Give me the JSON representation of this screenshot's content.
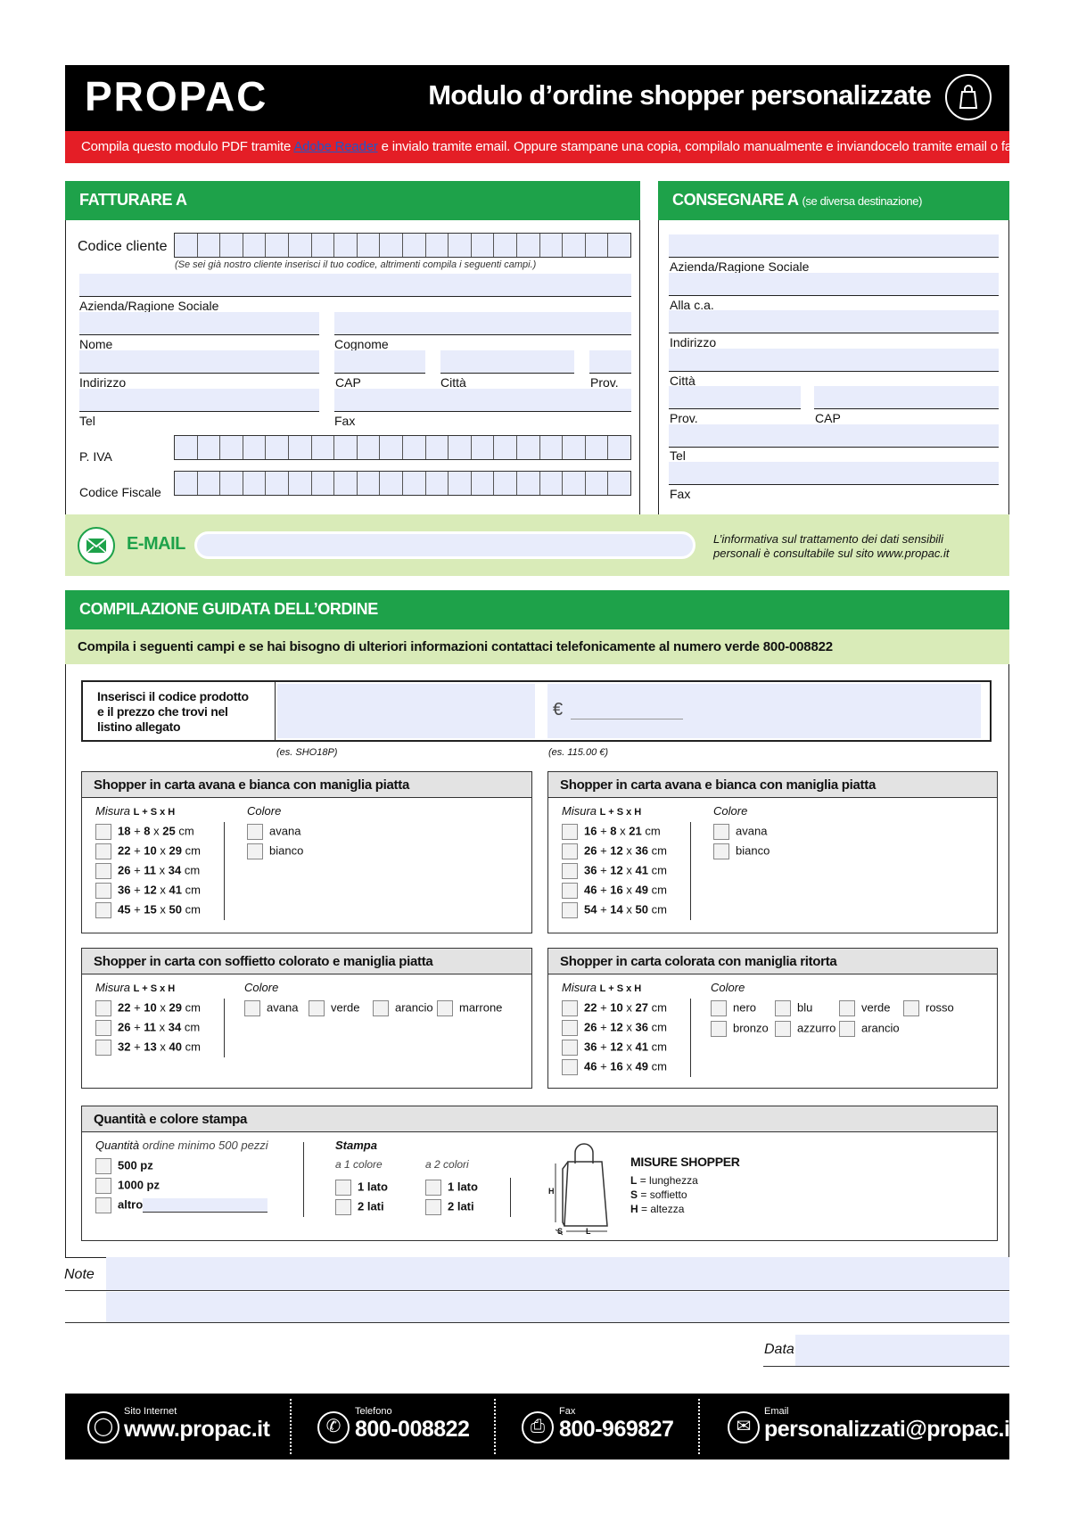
{
  "header": {
    "logo": "PROPAC",
    "title": "Modulo d’ordine shopper personalizzate",
    "instructions_before": "Compila questo modulo PDF tramite ",
    "instructions_link": "Adobe Reader",
    "instructions_after": " e invialo tramite email. Oppure stampane una copia, compilalo manualmente e inviandocelo tramite email o fax."
  },
  "billing": {
    "heading": "FATTURARE A",
    "customer_code_label": "Codice cliente",
    "customer_code_hint": "(Se sei già nostro cliente inserisci il tuo codice, altrimenti compila i seguenti campi.)",
    "company_label": "Azienda/Ragione Sociale",
    "name_label": "Nome",
    "surname_label": "Cognome",
    "address_label": "Indirizzo",
    "cap_label": "CAP",
    "city_label": "Città",
    "prov_label": "Prov.",
    "tel_label": "Tel",
    "fax_label": "Fax",
    "vat_label": "P. IVA",
    "fiscal_label": "Codice Fiscale"
  },
  "shipping": {
    "heading": "CONSEGNARE A",
    "heading_note": "(se diversa destinazione)",
    "company_label": "Azienda/Ragione Sociale",
    "attention_label": "Alla c.a.",
    "address_label": "Indirizzo",
    "city_label": "Città",
    "prov_label": "Prov.",
    "cap_label": "CAP",
    "tel_label": "Tel",
    "fax_label": "Fax"
  },
  "email": {
    "label": "E-MAIL",
    "privacy_text_1": "L’informativa sul trattamento dei dati sensibili",
    "privacy_text_2": "personali è consultabile sul sito www.propac.it"
  },
  "order": {
    "heading": "COMPILAZIONE GUIDATA DELL’ORDINE",
    "instructions": "Compila i seguenti campi e se hai bisogno di ulteriori informazioni contattaci telefonicamente al numero verde 800-008822",
    "product_prompt_1": "Inserisci il codice prodotto",
    "product_prompt_2": "e il prezzo che trovi nel",
    "product_prompt_3": "listino allegato",
    "euro_symbol": "€",
    "code_example": "(es. SHO18P)",
    "price_example": "(es. 115.00 €)"
  },
  "size_label_prefix": "Misura",
  "size_label_formula": "L + S x H",
  "color_label": "Colore",
  "boxes": [
    {
      "title": "Shopper in carta avana e bianca con maniglia piatta",
      "sizes": [
        [
          "18",
          "8",
          "25"
        ],
        [
          "22",
          "10",
          "29"
        ],
        [
          "26",
          "11",
          "34"
        ],
        [
          "36",
          "12",
          "41"
        ],
        [
          "45",
          "15",
          "50"
        ]
      ],
      "colors": [
        "avana",
        "bianco"
      ]
    },
    {
      "title": "Shopper in carta avana e bianca con maniglia piatta",
      "sizes": [
        [
          "16",
          "8",
          "21"
        ],
        [
          "26",
          "12",
          "36"
        ],
        [
          "36",
          "12",
          "41"
        ],
        [
          "46",
          "16",
          "49"
        ],
        [
          "54",
          "14",
          "50"
        ]
      ],
      "colors": [
        "avana",
        "bianco"
      ]
    },
    {
      "title": "Shopper in carta con soffietto colorato e maniglia piatta",
      "sizes": [
        [
          "22",
          "10",
          "29"
        ],
        [
          "26",
          "11",
          "34"
        ],
        [
          "32",
          "13",
          "40"
        ]
      ],
      "colors": [
        "avana",
        "verde",
        "arancio",
        "marrone"
      ]
    },
    {
      "title": "Shopper in carta colorata con maniglia ritorta",
      "sizes": [
        [
          "22",
          "10",
          "27"
        ],
        [
          "26",
          "12",
          "36"
        ],
        [
          "36",
          "12",
          "41"
        ],
        [
          "46",
          "16",
          "49"
        ]
      ],
      "colors": [
        "nero",
        "blu",
        "verde",
        "rosso",
        "bronzo",
        "azzurro",
        "arancio"
      ]
    }
  ],
  "unit_cm": "cm",
  "quantity": {
    "title": "Quantità e colore stampa",
    "qty_label": "Quantità",
    "qty_note": "ordine minimo 500 pezzi",
    "options": [
      "500 pz",
      "1000 pz",
      "altro"
    ],
    "print_label": "Stampa",
    "one_color": "a 1 colore",
    "two_colors": "a 2 colori",
    "one_side": "1 lato",
    "two_sides": "2 lati",
    "sizes_title": "MISURE SHOPPER",
    "legend": [
      {
        "key": "L",
        "desc": "= lunghezza"
      },
      {
        "key": "S",
        "desc": "= soffietto"
      },
      {
        "key": "H",
        "desc": "= altezza"
      }
    ]
  },
  "notes": {
    "label": "Note",
    "date_label": "Data"
  },
  "footer": {
    "website_label": "Sito Internet",
    "website": "www.propac.it",
    "phone_label": "Telefono",
    "phone": "800-008822",
    "fax_label": "Fax",
    "fax": "800-969827",
    "email_label": "Email",
    "email": "personalizzati@propac.it"
  }
}
